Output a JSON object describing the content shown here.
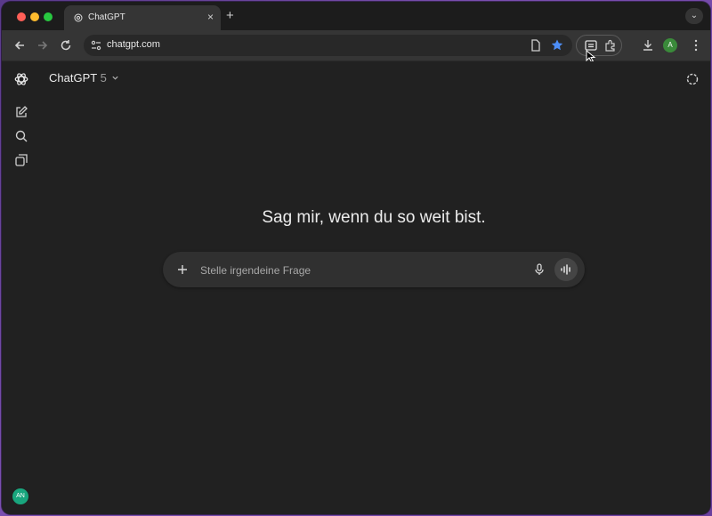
{
  "browser": {
    "tab_title": "ChatGPT",
    "tab_close": "×",
    "new_tab": "+",
    "tab_menu": "⌄",
    "url": "chatgpt.com",
    "profile_initial": "A",
    "colors": {
      "accent_star": "#4d8ef8",
      "profile": "#3a8a3a"
    }
  },
  "app": {
    "model_name": "ChatGPT",
    "model_version": "5",
    "headline": "Sag mir, wenn du so weit bist.",
    "composer": {
      "placeholder": "Stelle irgendeine Frage"
    },
    "user_initials": "AN",
    "icons": [
      "openai-logo-icon",
      "new-chat-icon",
      "search-icon",
      "library-icon",
      "temporary-chat-icon",
      "plus-icon",
      "microphone-icon",
      "voice-mode-icon"
    ]
  }
}
